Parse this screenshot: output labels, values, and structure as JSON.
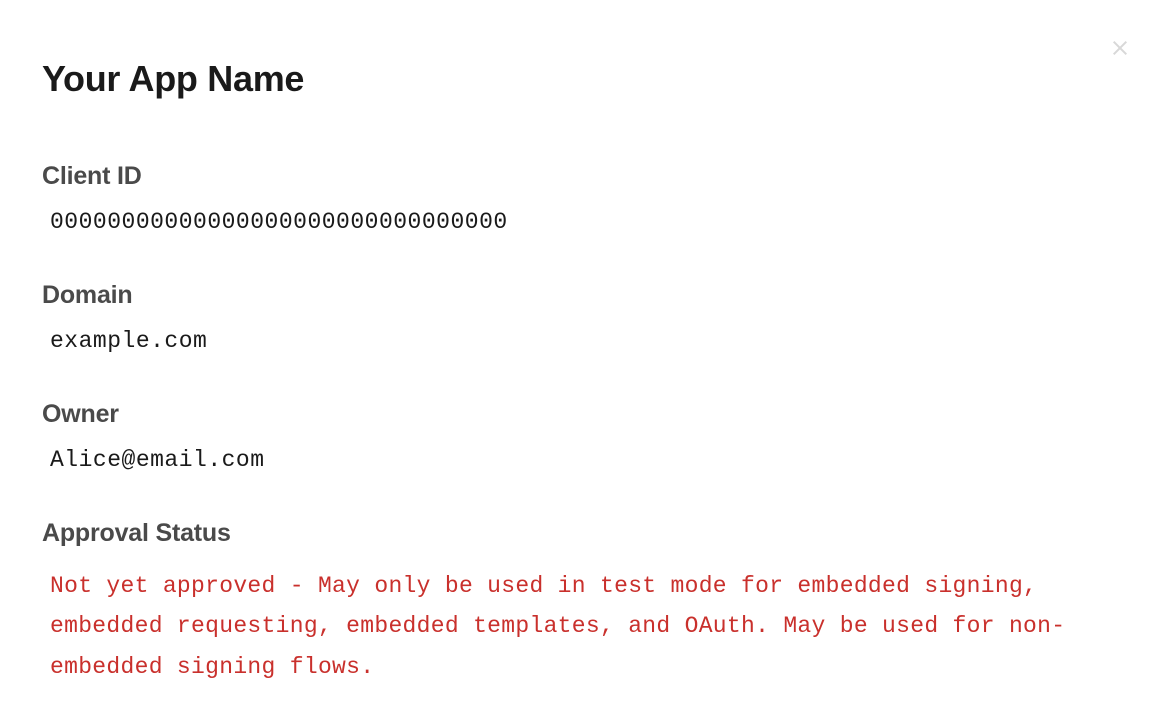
{
  "app": {
    "title": "Your App Name"
  },
  "fields": {
    "client_id": {
      "label": "Client ID",
      "value": "00000000000000000000000000000000"
    },
    "domain": {
      "label": "Domain",
      "value": "example.com"
    },
    "owner": {
      "label": "Owner",
      "value": "Alice@email.com"
    },
    "approval_status": {
      "label": "Approval Status",
      "value": "Not yet approved - May only be used in test mode for embedded signing, embedded requesting, embedded templates, and OAuth. May be used for non-embedded signing flows."
    }
  },
  "colors": {
    "error": "#c9302c",
    "label": "#4a4a4a",
    "text": "#1a1a1a",
    "close": "#d8d8d8"
  }
}
